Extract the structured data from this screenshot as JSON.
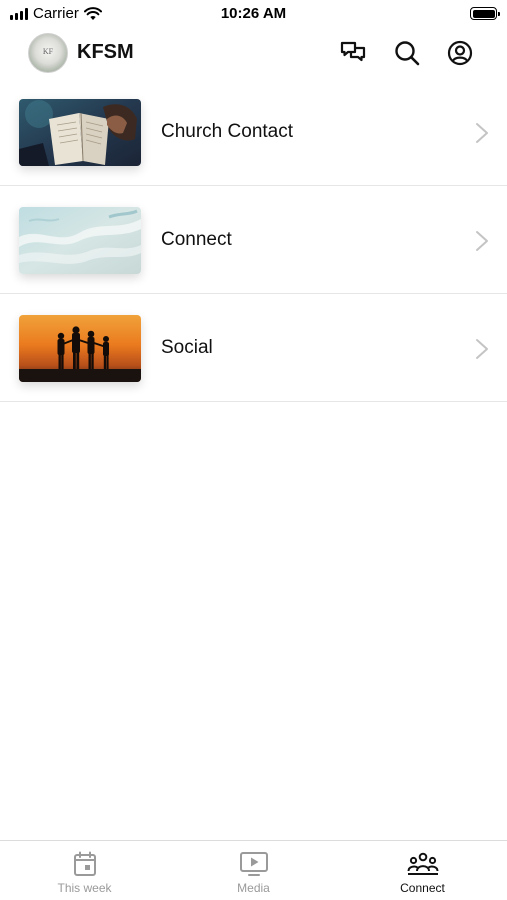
{
  "status_bar": {
    "carrier": "Carrier",
    "time": "10:26 AM",
    "signal_bars": 4,
    "wifi_icon": "wifi-icon",
    "battery_icon": "battery-full-icon"
  },
  "header": {
    "avatar_monogram": "KF",
    "title": "KFSM",
    "icons": [
      "chat-bubbles-icon",
      "search-icon",
      "account-circle-icon"
    ]
  },
  "list": {
    "items": [
      {
        "label": "Church Contact",
        "thumbnail": "bible-reading-photo"
      },
      {
        "label": "Connect",
        "thumbnail": "ocean-waves-photo"
      },
      {
        "label": "Social",
        "thumbnail": "sunset-silhouettes-photo"
      }
    ]
  },
  "tabs": [
    {
      "label": "This week",
      "icon": "calendar-icon",
      "active": false
    },
    {
      "label": "Media",
      "icon": "play-screen-icon",
      "active": false
    },
    {
      "label": "Connect",
      "icon": "people-group-icon",
      "active": true
    }
  ],
  "colors": {
    "active_tab": "#111111",
    "inactive_tab": "#9a9a9a",
    "divider": "#e6e6e6",
    "chevron": "#c4c4c4"
  }
}
